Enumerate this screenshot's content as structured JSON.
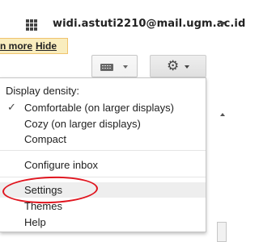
{
  "account": {
    "email": "widi.astuti2210@mail.ugm.ac.id",
    "apps_icon": "apps-grid-icon",
    "caret_icon": "caret-down-icon"
  },
  "notice": {
    "learn_more_fragment": "n more",
    "hide": "Hide"
  },
  "toolbar": {
    "density_icon": "keyboard-icon",
    "settings_icon": "gear-icon",
    "settings_glyph": "⚙"
  },
  "menu": {
    "heading": "Display density:",
    "density_options": [
      {
        "label": "Comfortable (on larger displays)",
        "checked": true
      },
      {
        "label": "Cozy (on larger displays)",
        "checked": false
      },
      {
        "label": "Compact",
        "checked": false
      }
    ],
    "check_glyph": "✓",
    "configure_inbox": "Configure inbox",
    "settings": "Settings",
    "themes": "Themes",
    "help": "Help"
  },
  "colors": {
    "annotation": "#e0141e",
    "notice_bg": "#f9edbe"
  }
}
